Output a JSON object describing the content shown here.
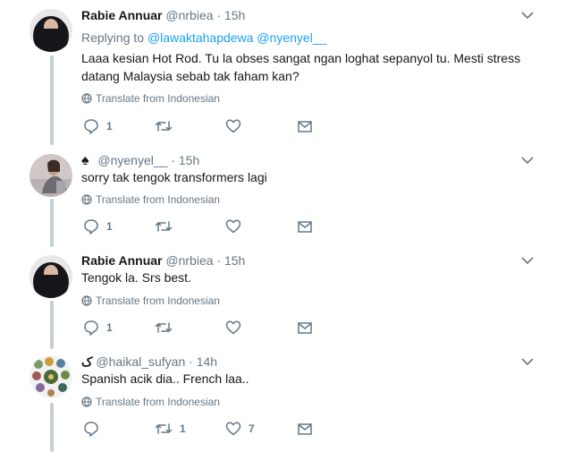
{
  "tweets": [
    {
      "name": "Rabie Annuar",
      "handle": "@nrbiea",
      "dot": "·",
      "time": "15h",
      "replying_prefix": "Replying to",
      "replying_users": [
        "@lawaktahapdewa",
        "@nyenyel__"
      ],
      "text": "Laaa kesian Hot Rod. Tu la obses sangat ngan loghat sepanyol tu. Mesti stress datang Malaysia sebab tak faham kan?",
      "translate": "Translate from Indonesian",
      "reply_count": "1",
      "retweet_count": "",
      "like_count": "",
      "avatar": "hijab-avatar"
    },
    {
      "name_symbol": "♠",
      "handle": "@nyenyel__",
      "dot": "·",
      "time": "15h",
      "text": "sorry tak tengok transformers lagi",
      "translate": "Translate from Indonesian",
      "reply_count": "1",
      "retweet_count": "",
      "like_count": "",
      "avatar": "photo-avatar"
    },
    {
      "name": "Rabie Annuar",
      "handle": "@nrbiea",
      "dot": "·",
      "time": "15h",
      "text": "Tengok la. Srs best.",
      "translate": "Translate from Indonesian",
      "reply_count": "1",
      "retweet_count": "",
      "like_count": "",
      "avatar": "hijab-avatar"
    },
    {
      "name_symbol": "ک",
      "handle": "@haikal_sufyan",
      "dot": "·",
      "time": "14h",
      "text": "Spanish acik dia.. French laa..",
      "translate": "Translate from Indonesian",
      "reply_count": "",
      "retweet_count": "1",
      "like_count": "7",
      "avatar": "collage-avatar"
    }
  ],
  "colors": {
    "link": "#1da1f2",
    "muted": "#657786",
    "thread": "#c4cfd6",
    "text": "#14171a"
  }
}
